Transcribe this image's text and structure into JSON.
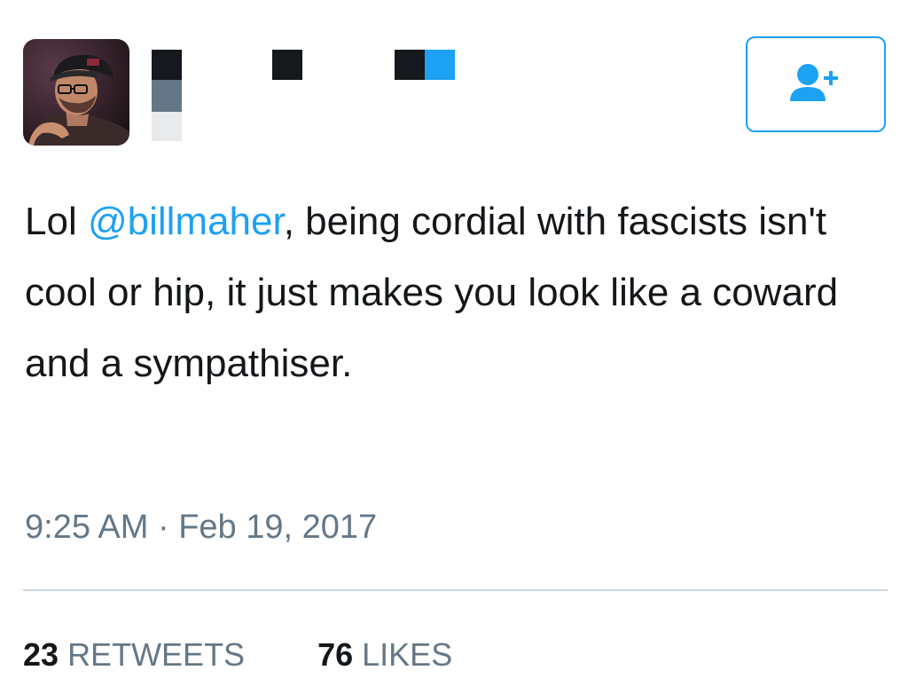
{
  "tweet": {
    "text_before_mention": "Lol ",
    "mention": "@billmaher",
    "text_after_mention": ", being cordial with fascists isn't cool or hip, it just makes you look like a coward and a sympathiser.",
    "timestamp": "9:25 AM · Feb 19, 2017"
  },
  "stats": {
    "retweets_count": "23",
    "retweets_label": "RETWEETS",
    "likes_count": "76",
    "likes_label": "LIKES"
  },
  "icons": {
    "follow": "add-user-icon"
  },
  "colors": {
    "accent": "#1da1f2",
    "text": "#14171a",
    "secondary": "#657786",
    "divider": "#ccd6dd"
  }
}
